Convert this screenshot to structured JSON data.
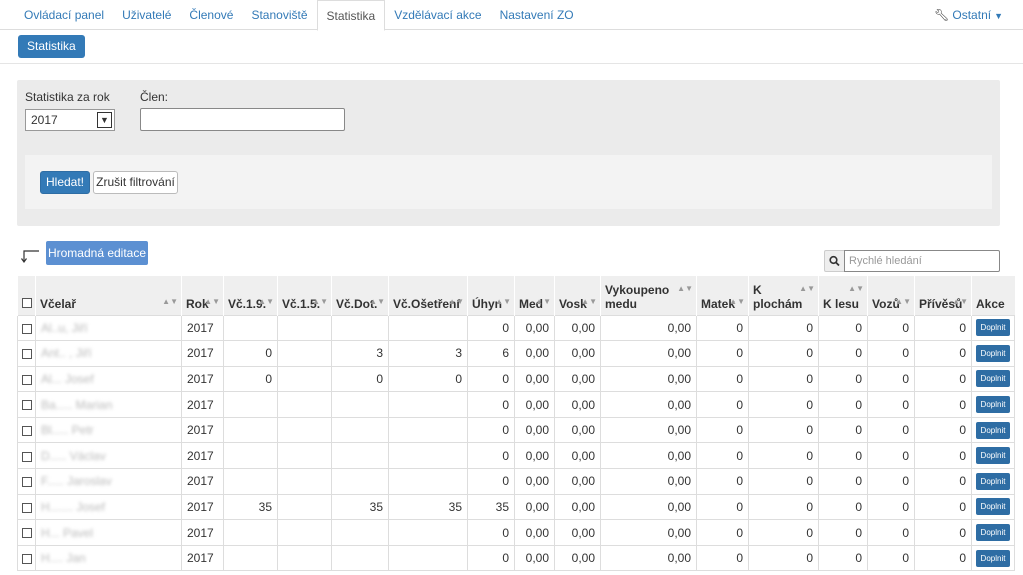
{
  "nav": {
    "tabs": [
      {
        "label": "Ovládací panel"
      },
      {
        "label": "Uživatelé"
      },
      {
        "label": "Členové"
      },
      {
        "label": "Stanoviště"
      },
      {
        "label": "Statistika"
      },
      {
        "label": "Vzdělávací akce"
      },
      {
        "label": "Nastavení ZO"
      }
    ],
    "ostatni": "Ostatní"
  },
  "subnav": {
    "label": "Statistika"
  },
  "filter": {
    "year_label": "Statistika za rok",
    "year_value": "2017",
    "member_label": "Člen:",
    "member_value": "",
    "search_btn": "Hledat!",
    "clear_btn": "Zrušit filtrování"
  },
  "bulk_edit": "Hromadná editace",
  "quick_search": {
    "placeholder": "Rychlé hledání"
  },
  "table": {
    "headers": {
      "vcelar": "Včelař",
      "rok": "Rok",
      "vc19": "Vč.1.9.",
      "vc15": "Vč.1.5.",
      "vcdot": "Vč.Dot.",
      "vcoset": "Vč.Ošetření",
      "uhyn": "Úhyn",
      "med": "Med",
      "vosk": "Vosk",
      "vykoupeno": "Vykoupeno medu",
      "matek": "Matek",
      "kplocham": "K plochám",
      "klesu": "K lesu",
      "vozu": "Vozů",
      "privesu": "Přívěsů",
      "akce": "Akce"
    },
    "action_label": "Doplnit",
    "rows": [
      {
        "name": "Al..u, Jiří",
        "rok": "2017",
        "vc19": "",
        "vc15": "",
        "vcdot": "",
        "vcoset": "",
        "uhyn": "0",
        "med": "0,00",
        "vosk": "0,00",
        "vyk": "0,00",
        "matek": "0",
        "kpl": "0",
        "kles": "0",
        "vozu": "0",
        "priv": "0"
      },
      {
        "name": "Ant.. , Jiří",
        "rok": "2017",
        "vc19": "0",
        "vc15": "",
        "vcdot": "3",
        "vcoset": "3",
        "uhyn": "6",
        "med": "0,00",
        "vosk": "0,00",
        "vyk": "0,00",
        "matek": "0",
        "kpl": "0",
        "kles": "0",
        "vozu": "0",
        "priv": "0"
      },
      {
        "name": "Al... Josef",
        "rok": "2017",
        "vc19": "0",
        "vc15": "",
        "vcdot": "0",
        "vcoset": "0",
        "uhyn": "0",
        "med": "0,00",
        "vosk": "0,00",
        "vyk": "0,00",
        "matek": "0",
        "kpl": "0",
        "kles": "0",
        "vozu": "0",
        "priv": "0"
      },
      {
        "name": "Ba..... Marian",
        "rok": "2017",
        "vc19": "",
        "vc15": "",
        "vcdot": "",
        "vcoset": "",
        "uhyn": "0",
        "med": "0,00",
        "vosk": "0,00",
        "vyk": "0,00",
        "matek": "0",
        "kpl": "0",
        "kles": "0",
        "vozu": "0",
        "priv": "0"
      },
      {
        "name": "Bl..... Petr",
        "rok": "2017",
        "vc19": "",
        "vc15": "",
        "vcdot": "",
        "vcoset": "",
        "uhyn": "0",
        "med": "0,00",
        "vosk": "0,00",
        "vyk": "0,00",
        "matek": "0",
        "kpl": "0",
        "kles": "0",
        "vozu": "0",
        "priv": "0"
      },
      {
        "name": "D..... Václav",
        "rok": "2017",
        "vc19": "",
        "vc15": "",
        "vcdot": "",
        "vcoset": "",
        "uhyn": "0",
        "med": "0,00",
        "vosk": "0,00",
        "vyk": "0,00",
        "matek": "0",
        "kpl": "0",
        "kles": "0",
        "vozu": "0",
        "priv": "0"
      },
      {
        "name": "F..... Jaroslav",
        "rok": "2017",
        "vc19": "",
        "vc15": "",
        "vcdot": "",
        "vcoset": "",
        "uhyn": "0",
        "med": "0,00",
        "vosk": "0,00",
        "vyk": "0,00",
        "matek": "0",
        "kpl": "0",
        "kles": "0",
        "vozu": "0",
        "priv": "0"
      },
      {
        "name": "H....... Josef",
        "rok": "2017",
        "vc19": "35",
        "vc15": "",
        "vcdot": "35",
        "vcoset": "35",
        "uhyn": "35",
        "med": "0,00",
        "vosk": "0,00",
        "vyk": "0,00",
        "matek": "0",
        "kpl": "0",
        "kles": "0",
        "vozu": "0",
        "priv": "0"
      },
      {
        "name": "H... Pavel",
        "rok": "2017",
        "vc19": "",
        "vc15": "",
        "vcdot": "",
        "vcoset": "",
        "uhyn": "0",
        "med": "0,00",
        "vosk": "0,00",
        "vyk": "0,00",
        "matek": "0",
        "kpl": "0",
        "kles": "0",
        "vozu": "0",
        "priv": "0"
      },
      {
        "name": "H.... Jan",
        "rok": "2017",
        "vc19": "",
        "vc15": "",
        "vcdot": "",
        "vcoset": "",
        "uhyn": "0",
        "med": "0,00",
        "vosk": "0,00",
        "vyk": "0,00",
        "matek": "0",
        "kpl": "0",
        "kles": "0",
        "vozu": "0",
        "priv": "0"
      }
    ]
  }
}
